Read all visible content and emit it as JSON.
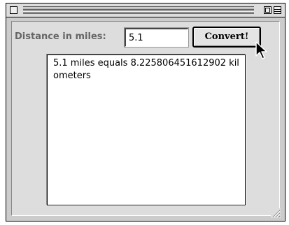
{
  "form": {
    "label": "Distance in miles:",
    "input_value": "5.1",
    "button_label": "Convert!"
  },
  "output": {
    "text": "5.1 miles equals 8.225806451612902 kilometers"
  },
  "icons": {
    "close": "close-box-icon",
    "zoom": "zoom-box-icon",
    "collapse": "collapse-box-icon",
    "resize": "resize-grip-icon",
    "cursor": "arrow-pointer-icon"
  },
  "colors": {
    "window_bg": "#cccccc",
    "content_bg": "#dddddd",
    "label_text": "#666666",
    "text": "#000000"
  }
}
